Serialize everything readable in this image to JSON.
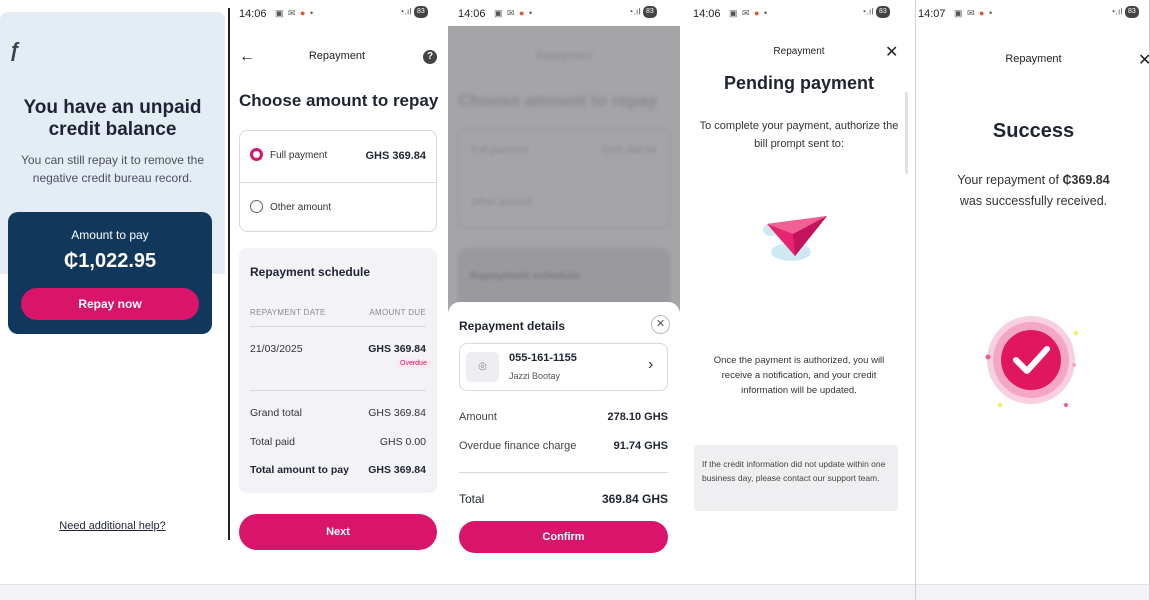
{
  "colors": {
    "accent": "#d8156b",
    "navy": "#12375c",
    "light_blue": "#e4ecf5"
  },
  "status_bar": {
    "time_a": "14:06",
    "time_b": "14:07",
    "battery": "83"
  },
  "panel1": {
    "logo": "ƒ",
    "title": "You have an unpaid credit balance",
    "subtitle": "You can still repay it to remove the negative credit bureau record.",
    "amount_label": "Amount to pay",
    "amount": "₵1,022.95",
    "repay_button": "Repay now",
    "help_link": "Need additional help?"
  },
  "panel2": {
    "header": "Repayment",
    "title": "Choose amount to repay",
    "options": [
      {
        "label": "Full payment",
        "value": "GHS 369.84",
        "selected": true
      },
      {
        "label": "Other amount",
        "value": "",
        "selected": false
      }
    ],
    "schedule": {
      "title": "Repayment schedule",
      "col_date": "REPAYMENT DATE",
      "col_amount": "AMOUNT DUE",
      "row_date": "21/03/2025",
      "row_amount": "GHS 369.84",
      "row_status": "Overdue",
      "grand_total_label": "Grand total",
      "grand_total": "GHS 369.84",
      "total_paid_label": "Total paid",
      "total_paid": "GHS 0.00",
      "total_pay_label": "Total amount to pay",
      "total_pay": "GHS 369.84"
    },
    "next_button": "Next"
  },
  "panel3": {
    "bg_header": "Repayment",
    "bg_title": "Choose amount to repay",
    "bg_option1": "Full payment",
    "bg_option1_value": "GHS 369.84",
    "bg_option2": "Other amount",
    "bg_schedule": "Repayment schedule",
    "sheet_title": "Repayment details",
    "account_number": "055-161-1155",
    "account_name": "Jazzi Bootay",
    "amount_label": "Amount",
    "amount_value": "278.10 GHS",
    "charge_label": "Overdue finance charge",
    "charge_value": "91.74 GHS",
    "total_label": "Total",
    "total_value": "369.84 GHS",
    "confirm_button": "Confirm"
  },
  "panel4": {
    "header": "Repayment",
    "title": "Pending payment",
    "subtitle": "To complete your payment, authorize the bill prompt sent to:",
    "note": "Once the payment is authorized, you will receive a notification, and your credit information will be updated.",
    "info_box": "If the credit information did not update within one business day, please contact our support team."
  },
  "panel5": {
    "header": "Repayment",
    "title": "Success",
    "message_prefix": "Your repayment of ",
    "message_amount": "₵369.84",
    "message_suffix": "was successfully received."
  }
}
